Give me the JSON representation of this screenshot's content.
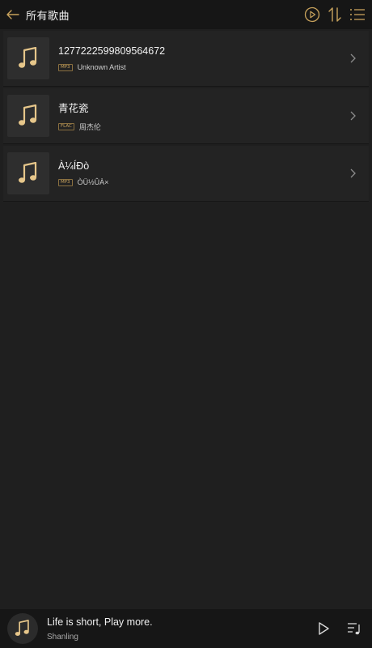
{
  "header": {
    "title": "所有歌曲",
    "icons": [
      "back-arrow-icon",
      "play-circle-icon",
      "sort-icon",
      "menu-list-icon"
    ]
  },
  "songs": [
    {
      "title": "1277222599809564672",
      "format": "MP3",
      "artist": "Unknown Artist"
    },
    {
      "title": "青花瓷",
      "format": "FLAC",
      "artist": "周杰伦"
    },
    {
      "title": "À¼ÍÐò",
      "format": "MP3",
      "artist": "ÒÜ½ÛÀ×"
    }
  ],
  "now_playing": {
    "title": "Life is short, Play more.",
    "artist": "Shanling"
  },
  "colors": {
    "accent": "#c8a25c",
    "background": "#1f1f1f",
    "bar": "#161616"
  }
}
